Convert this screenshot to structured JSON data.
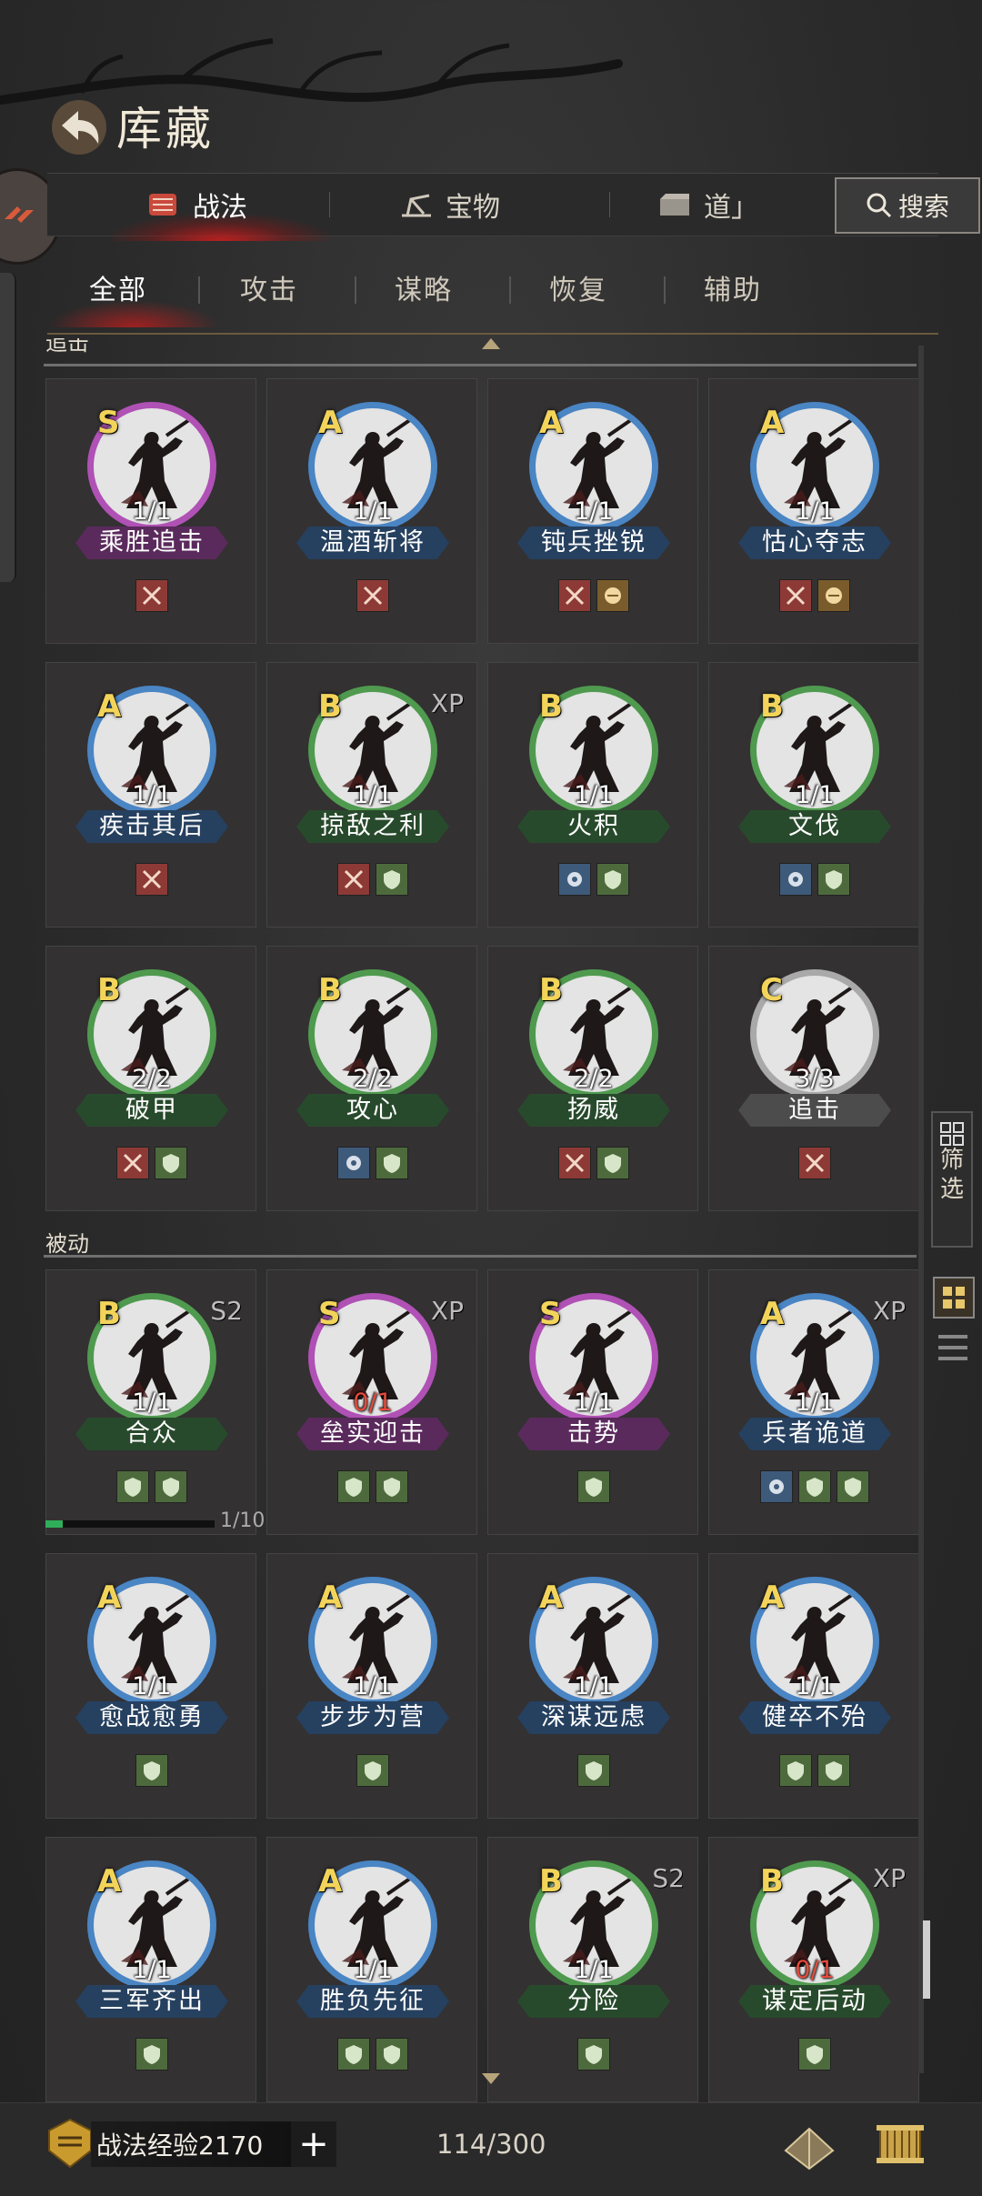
{
  "header": {
    "title": "库藏"
  },
  "tabs": [
    {
      "label": "战法",
      "active": true
    },
    {
      "label": "宝物",
      "active": false
    },
    {
      "label": "道」",
      "active": false
    }
  ],
  "search": {
    "label": "搜索"
  },
  "subtabs": [
    {
      "label": "全部",
      "active": true
    },
    {
      "label": "攻击",
      "active": false
    },
    {
      "label": "谋略",
      "active": false
    },
    {
      "label": "恢复",
      "active": false
    },
    {
      "label": "辅助",
      "active": false
    }
  ],
  "sections": {
    "active_label": "追击",
    "passive_label": "被动"
  },
  "colors": {
    "S": "#b051b5",
    "A": "#4a85c4",
    "B": "#4f9a4f",
    "C": "#a9a9a9",
    "name_S": "#5a2a5c",
    "name_A": "#26405f",
    "name_B": "#284a2c",
    "name_C": "#4c4c4c"
  },
  "cards": [
    {
      "grade": "S",
      "tag": "",
      "count": "1/1",
      "count_red": false,
      "name": "乘胜追击",
      "icons": [
        "atk-icon"
      ]
    },
    {
      "grade": "A",
      "tag": "",
      "count": "1/1",
      "count_red": false,
      "name": "温酒斩将",
      "icons": [
        "atk-icon"
      ]
    },
    {
      "grade": "A",
      "tag": "",
      "count": "1/1",
      "count_red": false,
      "name": "钝兵挫锐",
      "icons": [
        "atk-icon",
        "cavalry-icon"
      ]
    },
    {
      "grade": "A",
      "tag": "",
      "count": "1/1",
      "count_red": false,
      "name": "怙心夺志",
      "icons": [
        "atk-icon",
        "cavalry-icon"
      ]
    },
    {
      "grade": "A",
      "tag": "",
      "count": "1/1",
      "count_red": false,
      "name": "疾击其后",
      "icons": [
        "atk-icon"
      ]
    },
    {
      "grade": "B",
      "tag": "XP",
      "count": "1/1",
      "count_red": false,
      "name": "掠敌之利",
      "icons": [
        "atk-icon",
        "shield-icon"
      ]
    },
    {
      "grade": "B",
      "tag": "",
      "count": "1/1",
      "count_red": false,
      "name": "火积",
      "icons": [
        "bow-icon",
        "shield-icon"
      ]
    },
    {
      "grade": "B",
      "tag": "",
      "count": "1/1",
      "count_red": false,
      "name": "文伐",
      "icons": [
        "bow-icon",
        "shield-icon"
      ]
    },
    {
      "grade": "B",
      "tag": "",
      "count": "2/2",
      "count_red": false,
      "name": "破甲",
      "icons": [
        "atk-icon",
        "shield-icon"
      ]
    },
    {
      "grade": "B",
      "tag": "",
      "count": "2/2",
      "count_red": false,
      "name": "攻心",
      "icons": [
        "bow-icon",
        "shield-icon"
      ]
    },
    {
      "grade": "B",
      "tag": "",
      "count": "2/2",
      "count_red": false,
      "name": "扬威",
      "icons": [
        "atk-icon",
        "shield-icon"
      ]
    },
    {
      "grade": "C",
      "tag": "",
      "count": "3/3",
      "count_red": false,
      "name": "追击",
      "icons": [
        "atk-icon"
      ]
    },
    {
      "grade": "B",
      "tag": "S2",
      "count": "1/1",
      "count_red": false,
      "name": "合众",
      "icons": [
        "shield-icon",
        "shield-icon"
      ]
    },
    {
      "grade": "S",
      "tag": "XP",
      "count": "0/1",
      "count_red": true,
      "name": "垒实迎击",
      "icons": [
        "shield-icon",
        "shield-icon"
      ]
    },
    {
      "grade": "S",
      "tag": "",
      "count": "1/1",
      "count_red": false,
      "name": "击势",
      "icons": [
        "shield-icon"
      ]
    },
    {
      "grade": "A",
      "tag": "XP",
      "count": "1/1",
      "count_red": false,
      "name": "兵者诡道",
      "icons": [
        "bow-icon",
        "shield-icon",
        "shield-icon"
      ]
    },
    {
      "grade": "A",
      "tag": "",
      "count": "1/1",
      "count_red": false,
      "name": "愈战愈勇",
      "icons": [
        "shield-icon"
      ]
    },
    {
      "grade": "A",
      "tag": "",
      "count": "1/1",
      "count_red": false,
      "name": "步步为营",
      "icons": [
        "shield-icon"
      ]
    },
    {
      "grade": "A",
      "tag": "",
      "count": "1/1",
      "count_red": false,
      "name": "深谋远虑",
      "icons": [
        "shield-icon"
      ]
    },
    {
      "grade": "A",
      "tag": "",
      "count": "1/1",
      "count_red": false,
      "name": "健卒不殆",
      "icons": [
        "shield-icon",
        "shield-icon"
      ]
    },
    {
      "grade": "A",
      "tag": "",
      "count": "1/1",
      "count_red": false,
      "name": "三军齐出",
      "icons": [
        "shield-icon"
      ]
    },
    {
      "grade": "A",
      "tag": "",
      "count": "1/1",
      "count_red": false,
      "name": "胜负先征",
      "icons": [
        "shield-icon",
        "shield-icon"
      ]
    },
    {
      "grade": "B",
      "tag": "S2",
      "count": "1/1",
      "count_red": false,
      "name": "分险",
      "icons": [
        "shield-icon"
      ]
    },
    {
      "grade": "B",
      "tag": "XP",
      "count": "0/1",
      "count_red": true,
      "name": "谋定后动",
      "icons": [
        "shield-icon"
      ]
    }
  ],
  "progress": {
    "label": "1/10",
    "value": 0.1
  },
  "filter": {
    "label1": "筛",
    "label2": "选"
  },
  "bottom": {
    "exp_label": "战法经验2170",
    "plus": "+",
    "capacity": "114/300"
  }
}
